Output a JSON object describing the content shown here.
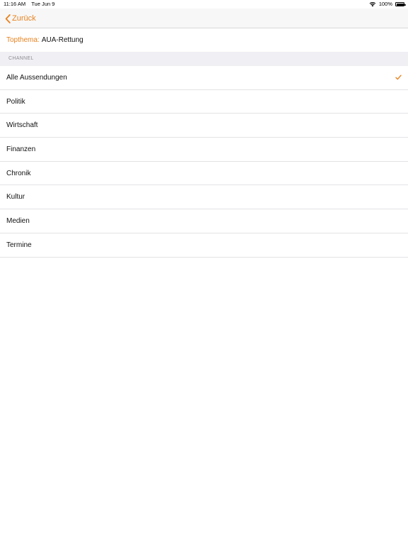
{
  "status_bar": {
    "time": "11:16 AM",
    "date": "Tue Jun 9",
    "battery": "100%"
  },
  "nav": {
    "back_label": "Zurück"
  },
  "topic": {
    "label": "Topthema:",
    "value": "AUA-Rettung"
  },
  "section": {
    "header": "CHANNEL"
  },
  "channels": [
    {
      "label": "Alle Aussendungen",
      "selected": true
    },
    {
      "label": "Politik",
      "selected": false
    },
    {
      "label": "Wirtschaft",
      "selected": false
    },
    {
      "label": "Finanzen",
      "selected": false
    },
    {
      "label": "Chronik",
      "selected": false
    },
    {
      "label": "Kultur",
      "selected": false
    },
    {
      "label": "Medien",
      "selected": false
    },
    {
      "label": "Termine",
      "selected": false
    }
  ],
  "colors": {
    "accent": "#e8821e",
    "nav_background": "#f7f7f7",
    "section_background": "#efeff4",
    "separator": "#e3e3e6"
  },
  "icons": {
    "back": "chevron-left-icon",
    "selected": "checkmark-icon",
    "wifi": "wifi-icon",
    "battery": "battery-icon"
  }
}
